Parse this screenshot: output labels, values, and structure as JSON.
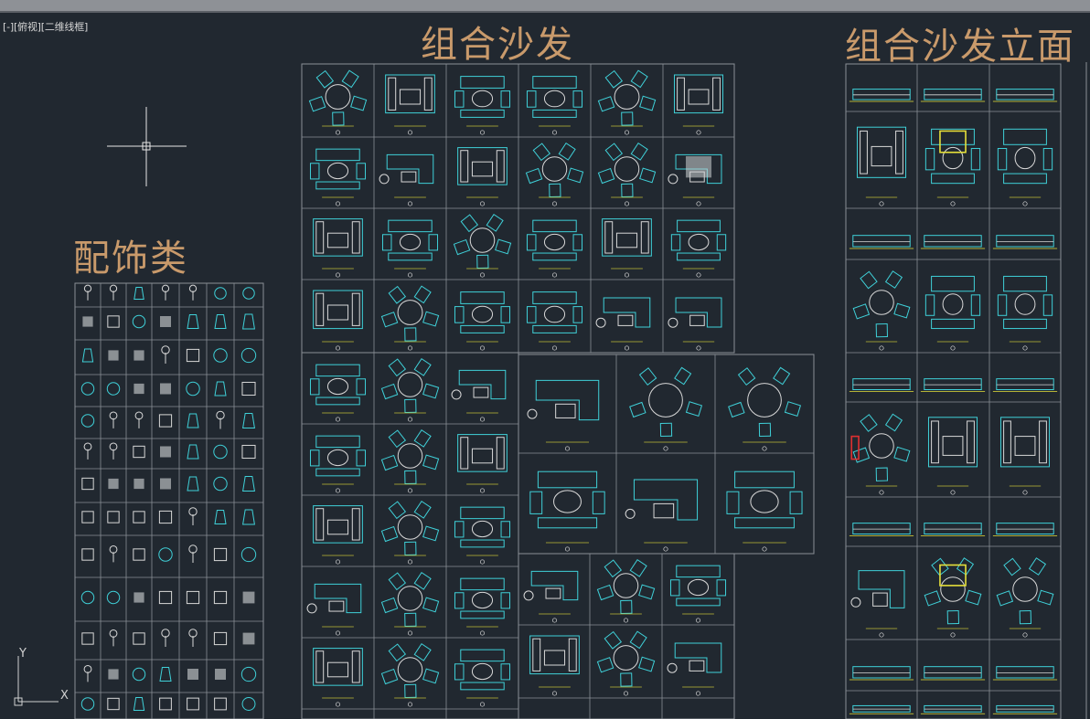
{
  "viewport": {
    "label": "[-][俯视][二维线框]"
  },
  "titles": {
    "sofa_combo": "组合沙发",
    "sofa_elevation": "组合沙发立面",
    "decor": "配饰类"
  },
  "ucs": {
    "x_axis": "X",
    "y_axis": "Y"
  },
  "colors": {
    "background": "#212830",
    "grid_line": "#8a8f96",
    "drawing_cyan": "#3fd0d8",
    "drawing_white": "#d8d8d8",
    "highlight_yellow": "#e6e03a",
    "highlight_red": "#e03030",
    "title_tan": "#c99a6b"
  }
}
